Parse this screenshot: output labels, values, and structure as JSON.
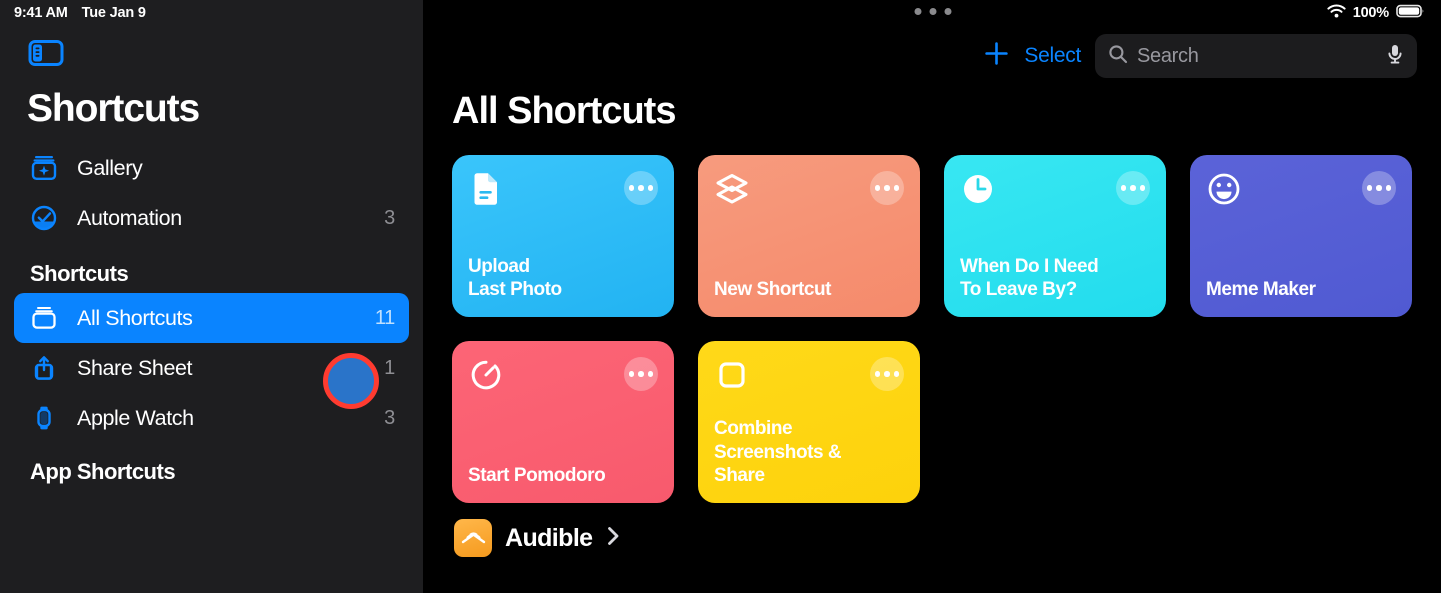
{
  "status_bar": {
    "time": "9:41 AM",
    "date": "Tue Jan 9",
    "battery_percent": "100%",
    "wifi_icon": "wifi-icon",
    "battery_icon": "battery-full-icon",
    "multitask_icon": "multitasking-dots-icon"
  },
  "sidebar": {
    "toggle_icon": "sidebar-toggle-icon",
    "app_title": "Shortcuts",
    "primary_items": [
      {
        "label": "Gallery",
        "count": "",
        "icon": "gallery-sparkle-icon"
      },
      {
        "label": "Automation",
        "count": "3",
        "icon": "automation-clock-icon"
      }
    ],
    "shortcuts_section_title": "Shortcuts",
    "shortcut_items": [
      {
        "label": "All Shortcuts",
        "count": "11",
        "icon": "all-shortcuts-stack-icon",
        "selected": true
      },
      {
        "label": "Share Sheet",
        "count": "1",
        "icon": "share-sheet-icon",
        "selected": false
      },
      {
        "label": "Apple Watch",
        "count": "3",
        "icon": "apple-watch-icon",
        "selected": false
      }
    ],
    "app_shortcuts_section_title": "App Shortcuts"
  },
  "toolbar": {
    "add_icon": "plus-icon",
    "select_label": "Select",
    "search_icon": "search-icon",
    "search_placeholder": "Search",
    "search_value": "",
    "mic_icon": "microphone-icon"
  },
  "main": {
    "page_title": "All Shortcuts",
    "cards": [
      {
        "title": "Upload\nLast Photo",
        "icon": "document-icon",
        "color_from": "#3ac5fb",
        "color_to": "#22b3f2"
      },
      {
        "title": "New Shortcut",
        "icon": "layers-icon",
        "color_from": "#f79b7e",
        "color_to": "#f58a6b"
      },
      {
        "title": "When Do I Need\nTo Leave By?",
        "icon": "clock-icon",
        "color_from": "#38e7f2",
        "color_to": "#22dced"
      },
      {
        "title": "Meme Maker",
        "icon": "smiley-icon",
        "color_from": "#5b63d8",
        "color_to": "#505ad2"
      },
      {
        "title": "Start Pomodoro",
        "icon": "timer-icon",
        "color_from": "#fc6576",
        "color_to": "#f85a6d"
      },
      {
        "title": "Combine\nScreenshots &\nShare",
        "icon": "square-icon",
        "color_from": "#ffd919",
        "color_to": "#fdd20b"
      }
    ],
    "app_sections": [
      {
        "name": "Audible",
        "icon": "audible-app-icon",
        "chevron": "chevron-right-icon"
      }
    ]
  },
  "annotation": {
    "type": "click-target-circle",
    "color": "#ff3b30"
  },
  "colors": {
    "accent_blue": "#0a84ff",
    "sidebar_bg": "#1e1e20",
    "main_bg": "#000000",
    "search_bg": "#1c1c1e",
    "count_gray": "#8e8e93"
  }
}
